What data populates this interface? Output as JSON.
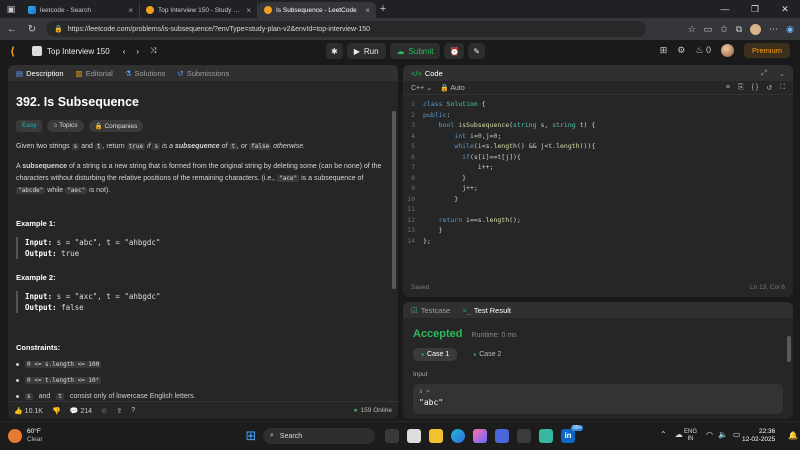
{
  "browser": {
    "tabs": [
      {
        "title": "leetcode - Search",
        "favicon": "bing-icon"
      },
      {
        "title": "Top Interview 150 - Study Plan - L",
        "favicon": "leetcode-icon"
      },
      {
        "title": "Is Subsequence - LeetCode",
        "favicon": "leetcode-icon"
      }
    ],
    "url": "https://leetcode.com/problems/is-subsequence/?envType=study-plan-v2&envId=top-interview-150"
  },
  "lc_header": {
    "list_name": "Top Interview 150",
    "run_label": "Run",
    "submit_label": "Submit",
    "streak": "0",
    "premium_label": "Premium"
  },
  "description": {
    "tabs": [
      "Description",
      "Editorial",
      "Solutions",
      "Submissions"
    ],
    "title": "392. Is Subsequence",
    "difficulty": "Easy",
    "topics_label": "Topics",
    "companies_label": "Companies",
    "p1_a": "Given two strings",
    "p1_s": "s",
    "p1_and": "and",
    "p1_t": "t",
    "p1_return": ", return",
    "p1_true": "true",
    "p1_if": "if",
    "p1_s2": "s",
    "p1_is_a": "is a",
    "p1_subseq": "subsequence",
    "p1_of": "of",
    "p1_t2": "t",
    "p1_or": ", or",
    "p1_false": "false",
    "p1_otherwise": "otherwise.",
    "p2_a": "A",
    "p2_subseq": "subsequence",
    "p2_rest": "of a string is a new string that is formed from the original string by deleting some (can be none) of the characters without disturbing the relative positions of the remaining characters. (i.e.,",
    "p2_ace": "\"ace\"",
    "p2_is_a": "is a subsequence of",
    "p2_abcde": "\"abcde\"",
    "p2_while": "while",
    "p2_aec": "\"aec\"",
    "p2_isnot": "is not).",
    "examples": [
      {
        "heading": "Example 1:",
        "input_label": "Input:",
        "input": "s = \"abc\", t = \"ahbgdc\"",
        "output_label": "Output:",
        "output": "true"
      },
      {
        "heading": "Example 2:",
        "input_label": "Input:",
        "input": "s = \"axc\", t = \"ahbgdc\"",
        "output_label": "Output:",
        "output": "false"
      }
    ],
    "constraints_heading": "Constraints:",
    "constraints": [
      "0 <= s.length <= 100",
      "0 <= t.length <= 10⁴"
    ],
    "c3_s": "s",
    "c3_and": "and",
    "c3_t": "t",
    "c3_rest": "consist only of lowercase English letters.",
    "likes": "10.1K",
    "comments": "214",
    "online": "159 Online"
  },
  "code": {
    "tab_label": "Code",
    "language": "C++",
    "mode": "Auto",
    "lines": [
      "class Solution {",
      "public:",
      "    bool isSubsequence(string s, string t) {",
      "        int i=0,j=0;",
      "        while(i<s.length() && j<t.length()){",
      "          if(s[i]==t[j]){",
      "              i++;",
      "          }",
      "          j++;",
      "        }",
      "",
      "    return i==s.length();",
      "    }",
      "};"
    ],
    "saved": "Saved",
    "cursor": "Ln 13, Col 6"
  },
  "result": {
    "testcase_label": "Testcase",
    "testresult_label": "Test Result",
    "status": "Accepted",
    "runtime": "Runtime: 0 ms",
    "cases": [
      "Case 1",
      "Case 2"
    ],
    "input_label": "Input",
    "input_key": "s =",
    "input_value": "\"abc\""
  },
  "taskbar": {
    "temp": "60°F",
    "weather": "Clear",
    "search": "Search",
    "lang1": "ENG",
    "lang2": "IN",
    "time": "22:36",
    "date": "12-02-2025",
    "badge": "99+"
  }
}
